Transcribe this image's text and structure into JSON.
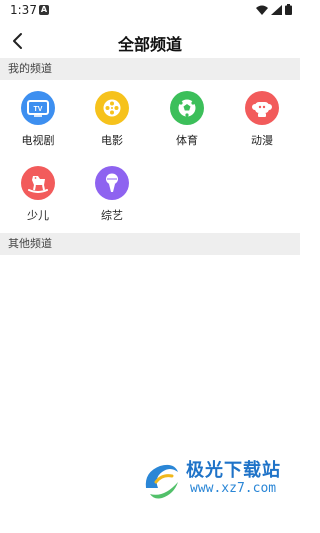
{
  "status_bar": {
    "time": "1:37",
    "notification_glyph": "A",
    "icons": [
      "wifi-icon",
      "signal-icon",
      "battery-icon"
    ]
  },
  "header": {
    "title": "全部频道",
    "back_icon": "chevron-left-icon"
  },
  "sections": {
    "my_channels": "我的频道",
    "other_channels": "其他频道"
  },
  "channels": [
    {
      "label": "电视剧",
      "icon": "tv-icon",
      "color": "#3d8ff0"
    },
    {
      "label": "电影",
      "icon": "film-reel-icon",
      "color": "#f6c21c"
    },
    {
      "label": "体育",
      "icon": "soccer-ball-icon",
      "color": "#3cbf5a"
    },
    {
      "label": "动漫",
      "icon": "anime-character-icon",
      "color": "#f25b5b"
    },
    {
      "label": "少儿",
      "icon": "rocking-horse-icon",
      "color": "#f25b5b"
    },
    {
      "label": "综艺",
      "icon": "microphone-icon",
      "color": "#8e63f0"
    }
  ],
  "watermark": {
    "brand": "极光下载站",
    "url": "www.xz7.com"
  }
}
